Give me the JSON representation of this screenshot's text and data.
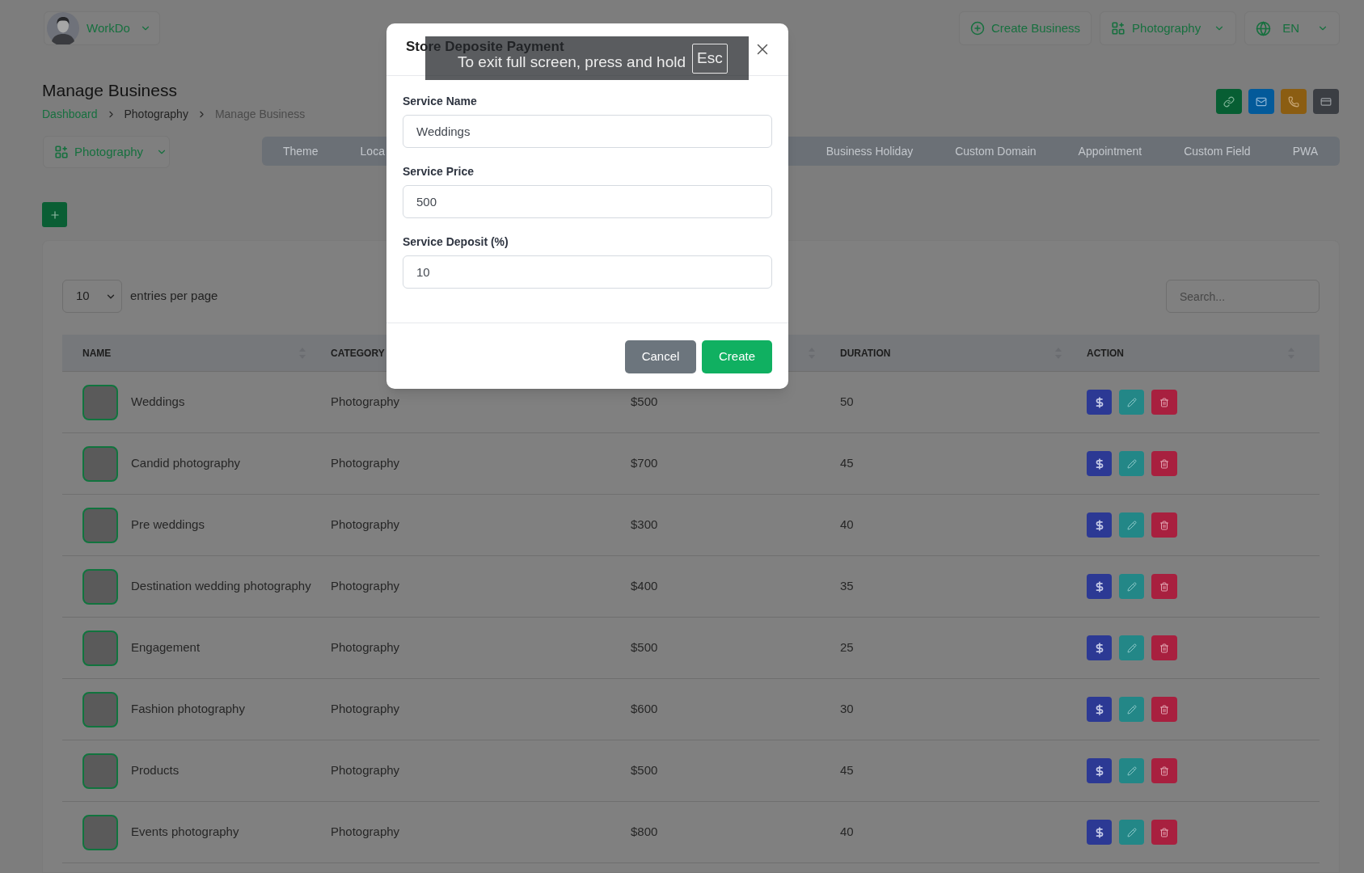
{
  "top_bar": {
    "account": {
      "name": "WorkDo"
    },
    "actions": [
      {
        "kind": "create",
        "label": "Create Business"
      },
      {
        "kind": "business",
        "label": "Photography"
      },
      {
        "kind": "language",
        "label": "EN"
      }
    ]
  },
  "page": {
    "title": "Manage Business",
    "breadcrumb": [
      {
        "kind": "link",
        "label": "Dashboard"
      },
      {
        "kind": "parent",
        "label": "Photography"
      },
      {
        "kind": "current",
        "label": "Manage Business"
      }
    ],
    "quick_actions": [
      {
        "kind": "link"
      },
      {
        "kind": "mail"
      },
      {
        "kind": "phone"
      },
      {
        "kind": "card"
      }
    ]
  },
  "business_select": {
    "label": "Photography"
  },
  "tab_bar": {
    "left_of_dialog": [
      "Theme",
      "Loca"
    ],
    "right_of_dialog": [
      "Business Holiday",
      "Custom Domain",
      "Appointment",
      "Custom Field",
      "PWA"
    ]
  },
  "table": {
    "page_size": {
      "value": "10",
      "label": "entries per page"
    },
    "search": {
      "placeholder": "Search..."
    },
    "columns": [
      {
        "label": "NAME"
      },
      {
        "label": "CATEGORY"
      },
      {},
      {
        "label": "DURATION"
      },
      {
        "label": "ACTION"
      }
    ],
    "rows": [
      {
        "name": "Weddings",
        "category": "Photography",
        "price": "$500",
        "duration": "50"
      },
      {
        "name": "Candid photography",
        "category": "Photography",
        "price": "$700",
        "duration": "45"
      },
      {
        "name": "Pre weddings",
        "category": "Photography",
        "price": "$300",
        "duration": "40"
      },
      {
        "name": "Destination wedding photography",
        "category": "Photography",
        "price": "$400",
        "duration": "35"
      },
      {
        "name": "Engagement",
        "category": "Photography",
        "price": "$500",
        "duration": "25"
      },
      {
        "name": "Fashion photography",
        "category": "Photography",
        "price": "$600",
        "duration": "30"
      },
      {
        "name": "Products",
        "category": "Photography",
        "price": "$500",
        "duration": "45"
      },
      {
        "name": "Events photography",
        "category": "Photography",
        "price": "$800",
        "duration": "40"
      }
    ]
  },
  "dialog": {
    "title": "Store Deposite Payment",
    "fields": [
      {
        "label": "Service Name",
        "value": "Weddings"
      },
      {
        "label": "Service Price",
        "value": "500"
      },
      {
        "label": "Service Deposit (%)",
        "value": "10"
      }
    ],
    "buttons": [
      {
        "kind": "secondary",
        "label": "Cancel"
      },
      {
        "kind": "primary",
        "label": "Create"
      }
    ]
  },
  "fullscreen_notice": {
    "text": "To exit full screen, press and hold",
    "key": "Esc"
  }
}
